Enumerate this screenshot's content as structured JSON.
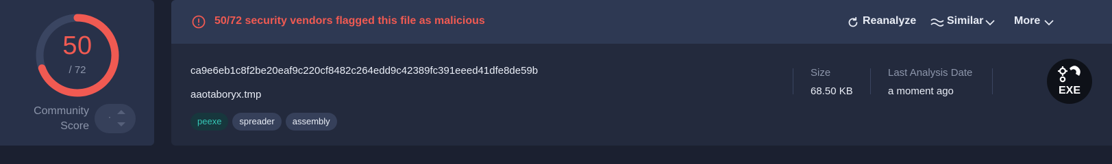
{
  "score": {
    "detected": "50",
    "total": "/ 72",
    "detected_fraction": 0.694,
    "ring_color": "#f05a52",
    "community_label_line1": "Community",
    "community_label_line2": "Score",
    "community_value": "·"
  },
  "alert": {
    "text": "50/72 security vendors flagged this file as malicious",
    "icon": "alert-circle-icon",
    "color": "#f05a52"
  },
  "actions": {
    "reanalyze": "Reanalyze",
    "similar": "Similar",
    "more": "More"
  },
  "file": {
    "hash": "ca9e6eb1c8f2be20eaf9c220cf8482c264edd9c42389fc391eeed41dfe8de59b",
    "name": "aaotaboryx.tmp",
    "tags": [
      "peexe",
      "spreader",
      "assembly"
    ]
  },
  "meta": {
    "size_label": "Size",
    "size_value": "68.50 KB",
    "date_label": "Last Analysis Date",
    "date_value": "a moment ago"
  },
  "file_type": {
    "label": "EXE",
    "icon": "gears-icon"
  }
}
